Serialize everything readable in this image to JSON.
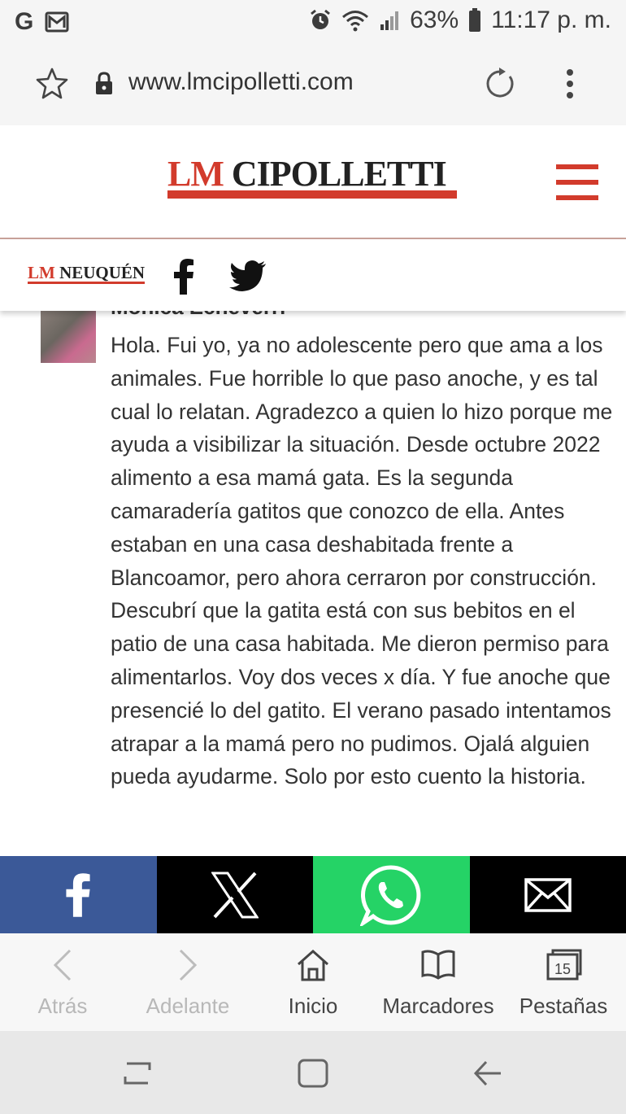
{
  "status_bar": {
    "battery": "63%",
    "time": "11:17 p. m."
  },
  "browser": {
    "url": "www.lmcipolletti.com"
  },
  "site": {
    "logo_lm": "LM",
    "logo_name": "CIPOLLETTI",
    "sub_logo_lm": "LM",
    "sub_logo_name": "NEUQUÉN"
  },
  "comment": {
    "author": "Monica Echeverri",
    "text": "Hola. Fui yo, ya no adolescente pero que ama a los animales. Fue horrible lo que paso anoche, y es tal cual lo relatan. Agradezco a quien lo hizo porque me ayuda a visibilizar la situación. Desde octubre 2022 alimento a esa mamá gata. Es la segunda camaradería gatitos que conozco de ella. Antes estaban en una casa deshabitada frente a Blancoamor, pero ahora cerraron por construcción. Descubrí que la gatita está con sus bebitos en el patio de una casa habitada. Me dieron permiso para alimentarlos. Voy dos veces x día. Y fue anoche que presencié lo del gatito. El verano pasado intentamos atrapar a la mamá pero no pudimos. Ojalá alguien pueda ayudarme. Solo por esto cuento la historia."
  },
  "share_bar": {
    "buttons": [
      "facebook-icon",
      "x-icon",
      "whatsapp-icon",
      "mail-icon"
    ],
    "colors": {
      "facebook": "#3b5998",
      "x": "#000000",
      "whatsapp": "#25d366",
      "mail": "#000000"
    }
  },
  "browser_nav": {
    "back": "Atrás",
    "forward": "Adelante",
    "home": "Inicio",
    "bookmarks": "Marcadores",
    "tabs": "Pestañas",
    "tab_count": "15"
  },
  "colors": {
    "brand_red": "#d23b2c"
  }
}
